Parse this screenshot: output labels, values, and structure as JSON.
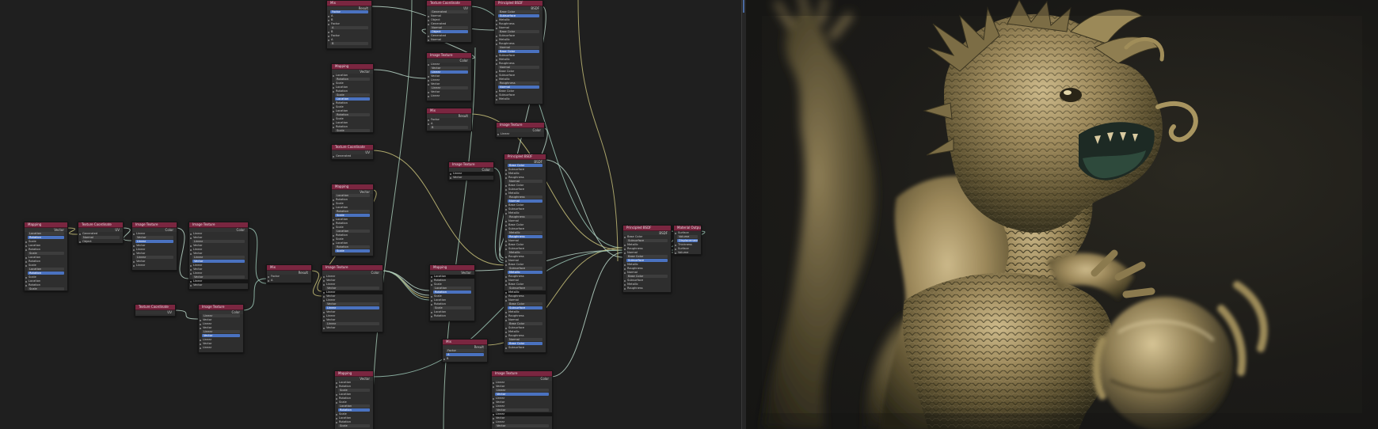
{
  "graph_nodes": [
    {
      "title": "Material Output",
      "sub": "",
      "rows": [
        "Surface",
        "Volume",
        "Displacement",
        "Thickness"
      ]
    },
    {
      "title": "Principled BSDF",
      "sub": "BSDF",
      "rows": [
        "Base Color",
        "Subsurface",
        "Metallic",
        "Roughness",
        "Normal"
      ]
    },
    {
      "title": "Image Texture",
      "sub": "Color",
      "rows": [
        "Linear",
        "Vector"
      ]
    },
    {
      "title": "Mapping",
      "sub": "Vector",
      "rows": [
        "Location",
        "Rotation",
        "Scale"
      ]
    },
    {
      "title": "Texture Coordinate",
      "sub": "UV",
      "rows": [
        "Generated",
        "Normal",
        "Object"
      ]
    },
    {
      "title": "Mix",
      "sub": "Result",
      "rows": [
        "Factor",
        "A",
        "B"
      ]
    }
  ]
}
